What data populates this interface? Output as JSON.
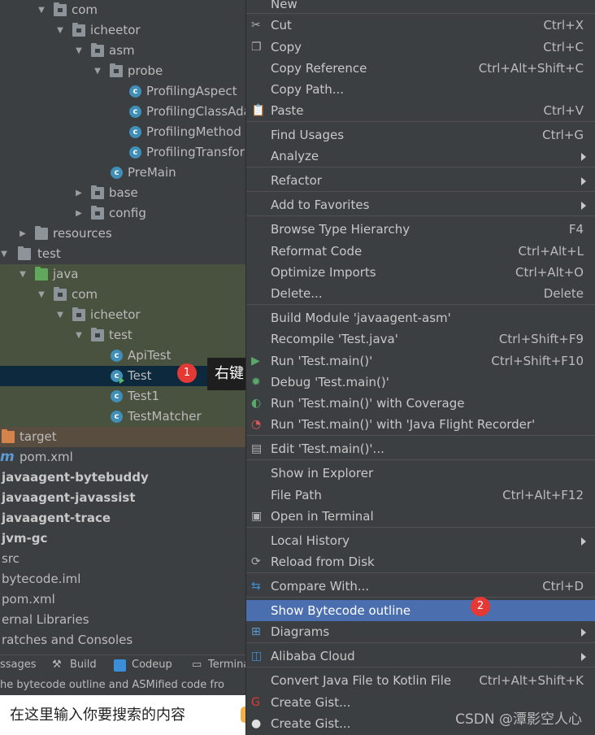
{
  "tree": {
    "rows": [
      {
        "label": "com",
        "type": "pkg",
        "indent": 2,
        "arrow": "down"
      },
      {
        "label": "icheetor",
        "type": "pkg",
        "indent": 3,
        "arrow": "down"
      },
      {
        "label": "asm",
        "type": "pkg",
        "indent": 4,
        "arrow": "down"
      },
      {
        "label": "probe",
        "type": "pkg",
        "indent": 5,
        "arrow": "down"
      },
      {
        "label": "ProfilingAspect",
        "type": "class",
        "indent": 7
      },
      {
        "label": "ProfilingClassAda",
        "type": "class",
        "indent": 7
      },
      {
        "label": "ProfilingMethod",
        "type": "class",
        "indent": 7
      },
      {
        "label": "ProfilingTransfor",
        "type": "class",
        "indent": 7
      },
      {
        "label": "PreMain",
        "type": "class",
        "indent": 6
      },
      {
        "label": "base",
        "type": "pkg",
        "indent": 4,
        "arrow": "right"
      },
      {
        "label": "config",
        "type": "pkg",
        "indent": 4,
        "arrow": "right"
      },
      {
        "label": "resources",
        "type": "res",
        "indent": 1,
        "arrow": "right"
      },
      {
        "label": "test",
        "type": "folder",
        "indent": 0,
        "arrow": "down"
      },
      {
        "label": "java",
        "type": "green",
        "indent": 1,
        "arrow": "down"
      },
      {
        "label": "com",
        "type": "pkg",
        "indent": 2,
        "arrow": "down"
      },
      {
        "label": "icheetor",
        "type": "pkg",
        "indent": 3,
        "arrow": "down"
      },
      {
        "label": "test",
        "type": "pkg",
        "indent": 4,
        "arrow": "down"
      },
      {
        "label": "ApiTest",
        "type": "class",
        "indent": 6
      },
      {
        "label": "Test",
        "type": "classrun",
        "indent": 6
      },
      {
        "label": "Test1",
        "type": "class",
        "indent": 6
      },
      {
        "label": "TestMatcher",
        "type": "class",
        "indent": 6
      },
      {
        "label": "target",
        "type": "orange",
        "indent": 0
      },
      {
        "label": "pom.xml",
        "type": "maven",
        "indent": 0
      },
      {
        "label": "javaagent-bytebuddy",
        "type": "bold",
        "indent": 0
      },
      {
        "label": "javaagent-javassist",
        "type": "bold",
        "indent": 0
      },
      {
        "label": "javaagent-trace",
        "type": "bold",
        "indent": 0
      },
      {
        "label": "jvm-gc",
        "type": "bold",
        "indent": 0
      },
      {
        "label": "src",
        "type": "plain",
        "indent": 0
      },
      {
        "label": "bytecode.iml",
        "type": "plain",
        "indent": 0
      },
      {
        "label": "pom.xml",
        "type": "plain",
        "indent": 0
      },
      {
        "label": "ernal Libraries",
        "type": "plain",
        "indent": 0
      },
      {
        "label": "ratches and Consoles",
        "type": "plain",
        "indent": 0
      }
    ]
  },
  "annotation": {
    "badge1": "1",
    "badge2": "2",
    "tooltip": "右键"
  },
  "toolwindows": {
    "messages": "ssages",
    "build": "Build",
    "codeup": "Codeup",
    "terminal": "Termina"
  },
  "status": {
    "text": "he bytecode outline and ASMified code fro"
  },
  "search": {
    "placeholder": "在这里输入你要搜索的内容"
  },
  "menu": {
    "items": [
      {
        "label": "New",
        "shortcut": "",
        "submenu": false,
        "icon": ""
      },
      {
        "label": "Cut",
        "shortcut": "Ctrl+X",
        "icon": "scissors"
      },
      {
        "label": "Copy",
        "shortcut": "Ctrl+C",
        "icon": "copy"
      },
      {
        "label": "Copy Reference",
        "shortcut": "Ctrl+Alt+Shift+C"
      },
      {
        "label": "Copy Path...",
        "shortcut": ""
      },
      {
        "label": "Paste",
        "shortcut": "Ctrl+V",
        "icon": "clipboard"
      },
      {
        "label": "Find Usages",
        "shortcut": "Ctrl+G"
      },
      {
        "label": "Analyze",
        "shortcut": "",
        "submenu": true
      },
      {
        "label": "Refactor",
        "shortcut": "",
        "submenu": true
      },
      {
        "label": "Add to Favorites",
        "shortcut": "",
        "submenu": true
      },
      {
        "label": "Browse Type Hierarchy",
        "shortcut": "F4"
      },
      {
        "label": "Reformat Code",
        "shortcut": "Ctrl+Alt+L"
      },
      {
        "label": "Optimize Imports",
        "shortcut": "Ctrl+Alt+O"
      },
      {
        "label": "Delete...",
        "shortcut": "Delete"
      },
      {
        "label": "Build Module 'javaagent-asm'",
        "shortcut": ""
      },
      {
        "label": "Recompile 'Test.java'",
        "shortcut": "Ctrl+Shift+F9"
      },
      {
        "label": "Run 'Test.main()'",
        "shortcut": "Ctrl+Shift+F10",
        "icon": "run"
      },
      {
        "label": "Debug 'Test.main()'",
        "shortcut": "",
        "icon": "debug"
      },
      {
        "label": "Run 'Test.main()' with Coverage",
        "shortcut": "",
        "icon": "coverage"
      },
      {
        "label": "Run 'Test.main()' with 'Java Flight Recorder'",
        "shortcut": "",
        "icon": "jfr"
      },
      {
        "label": "Edit 'Test.main()'...",
        "shortcut": "",
        "icon": "edit-config"
      },
      {
        "label": "Show in Explorer",
        "shortcut": ""
      },
      {
        "label": "File Path",
        "shortcut": "Ctrl+Alt+F12"
      },
      {
        "label": "Open in Terminal",
        "shortcut": "",
        "icon": "terminal"
      },
      {
        "label": "Local History",
        "shortcut": "",
        "submenu": true
      },
      {
        "label": "Reload from Disk",
        "shortcut": "",
        "icon": "reload"
      },
      {
        "label": "Compare With...",
        "shortcut": "Ctrl+D",
        "icon": "compare"
      },
      {
        "label": "Show Bytecode outline",
        "shortcut": "",
        "highlight": true
      },
      {
        "label": "Diagrams",
        "shortcut": "",
        "submenu": true,
        "icon": "diagram"
      },
      {
        "label": "Alibaba Cloud",
        "shortcut": "",
        "submenu": true,
        "icon": "alibaba"
      },
      {
        "label": "Convert Java File to Kotlin File",
        "shortcut": "Ctrl+Alt+Shift+K"
      },
      {
        "label": "Create Gist...",
        "shortcut": "",
        "icon": "gist-red"
      },
      {
        "label": "Create Gist...",
        "shortcut": "",
        "icon": "github"
      }
    ]
  },
  "watermark": "CSDN @潭影空人心"
}
